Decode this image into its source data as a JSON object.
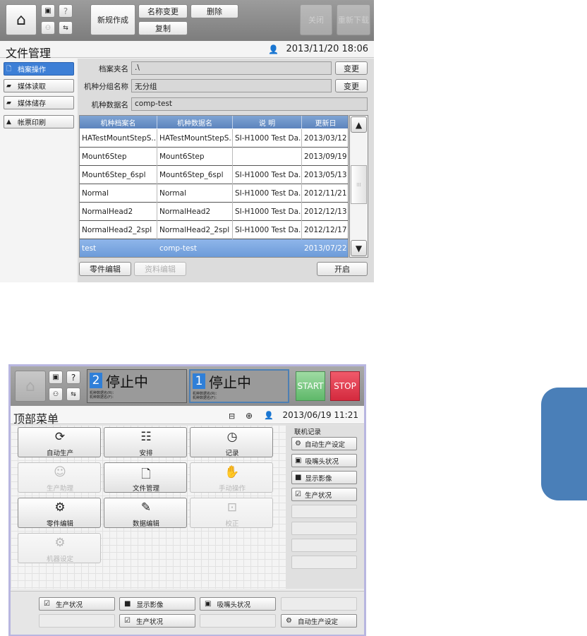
{
  "screen1": {
    "toolbar": {
      "new_label": "新规作成",
      "rename_label": "名称变更",
      "delete_label": "删除",
      "copy_label": "复制",
      "close_label": "关闭",
      "redownload_label": "重新下载"
    },
    "title": "文件管理",
    "datetime": "2013/11/20 18:06",
    "sidebar": [
      {
        "label": "档案操作",
        "icon": "file-operation-icon"
      },
      {
        "label": "媒体读取",
        "icon": "media-read-icon"
      },
      {
        "label": "媒体储存",
        "icon": "media-save-icon"
      },
      {
        "label": "帐票印刷",
        "icon": "print-icon"
      }
    ],
    "fields": {
      "folder_label": "档案夹名",
      "folder_value": ".\\",
      "group_label": "机种分组名称",
      "group_value": "无分组",
      "data_label": "机种数据名",
      "data_value": "comp-test",
      "change_label": "变更"
    },
    "table": {
      "headers": [
        "机种档案名",
        "机种数据名",
        "说 明",
        "更新日"
      ],
      "rows": [
        [
          "HATestMountStepS...",
          "HATestMountStepS...",
          "SI-H1000 Test Da...",
          "2013/03/12"
        ],
        [
          "Mount6Step",
          "Mount6Step",
          "",
          "2013/09/19"
        ],
        [
          "Mount6Step_6spl",
          "Mount6Step_6spl",
          "SI-H1000 Test Da...",
          "2013/05/13"
        ],
        [
          "Normal",
          "Normal",
          "SI-H1000 Test Da...",
          "2012/11/21"
        ],
        [
          "NormalHead2",
          "NormalHead2",
          "SI-H1000 Test Da...",
          "2012/12/13"
        ],
        [
          "NormalHead2_2spl",
          "NormalHead2_2spl",
          "SI-H1000 Test Da...",
          "2012/12/17"
        ],
        [
          "test",
          "comp-test",
          "",
          "2013/07/22"
        ]
      ]
    },
    "bottom": {
      "parts_edit": "零件编辑",
      "data_edit": "资料编辑",
      "open": "开启"
    }
  },
  "screen2": {
    "lane2": {
      "num": "2",
      "status": "停止中",
      "sub1": "机种数据名(R)：",
      "sub2": "机种数据名(F)："
    },
    "lane1": {
      "num": "1",
      "status": "停止中",
      "sub1": "机种数据名(R)：",
      "sub2": "机种数据名(F)："
    },
    "start_label": "START",
    "stop_label": "STOP",
    "title": "顶部菜单",
    "datetime": "2013/06/19 11:21",
    "menu": [
      {
        "label": "自动生产",
        "icon": "auto-icon",
        "glyph": "⟳",
        "disabled": false
      },
      {
        "label": "安排",
        "icon": "schedule-icon",
        "glyph": "☷",
        "disabled": false
      },
      {
        "label": "记录",
        "icon": "history-icon",
        "glyph": "◷",
        "disabled": false
      },
      {
        "label": "生产助理",
        "icon": "assistant-icon",
        "glyph": "☺",
        "disabled": true
      },
      {
        "label": "文件管理",
        "icon": "file-icon",
        "glyph": "🗋",
        "disabled": false
      },
      {
        "label": "手动操作",
        "icon": "manual-icon",
        "glyph": "✋",
        "disabled": true
      },
      {
        "label": "零件编辑",
        "icon": "parts-edit-icon",
        "glyph": "⚙",
        "disabled": false
      },
      {
        "label": "数据编辑",
        "icon": "data-edit-icon",
        "glyph": "✎",
        "disabled": false
      },
      {
        "label": "校正",
        "icon": "calibrate-icon",
        "glyph": "⊡",
        "disabled": true
      },
      {
        "label": "机器设定",
        "icon": "machine-setting-icon",
        "glyph": "⚙",
        "disabled": true
      }
    ],
    "right_panel": {
      "title": "联机记录",
      "items": [
        {
          "label": "自动生产设定",
          "icon": "auto-setting-icon",
          "glyph": "⚙"
        },
        {
          "label": "吸嘴头状况",
          "icon": "nozzle-icon",
          "glyph": "▣"
        },
        {
          "label": "显示影像",
          "icon": "camera-icon",
          "glyph": "■"
        },
        {
          "label": "生产状况",
          "icon": "production-status-icon",
          "glyph": "☑"
        }
      ]
    },
    "bottom": {
      "row1": [
        {
          "label": "生产状况",
          "icon": "production-status-icon",
          "glyph": "☑"
        },
        {
          "label": "显示影像",
          "icon": "camera-icon",
          "glyph": "■"
        },
        {
          "label": "吸嘴头状况",
          "icon": "nozzle-icon",
          "glyph": "▣"
        }
      ],
      "row2_mid": {
        "label": "生产状况",
        "icon": "production-status-icon",
        "glyph": "☑"
      },
      "row2_right": {
        "label": "自动生产设定",
        "icon": "auto-setting-icon",
        "glyph": "⚙"
      }
    }
  }
}
